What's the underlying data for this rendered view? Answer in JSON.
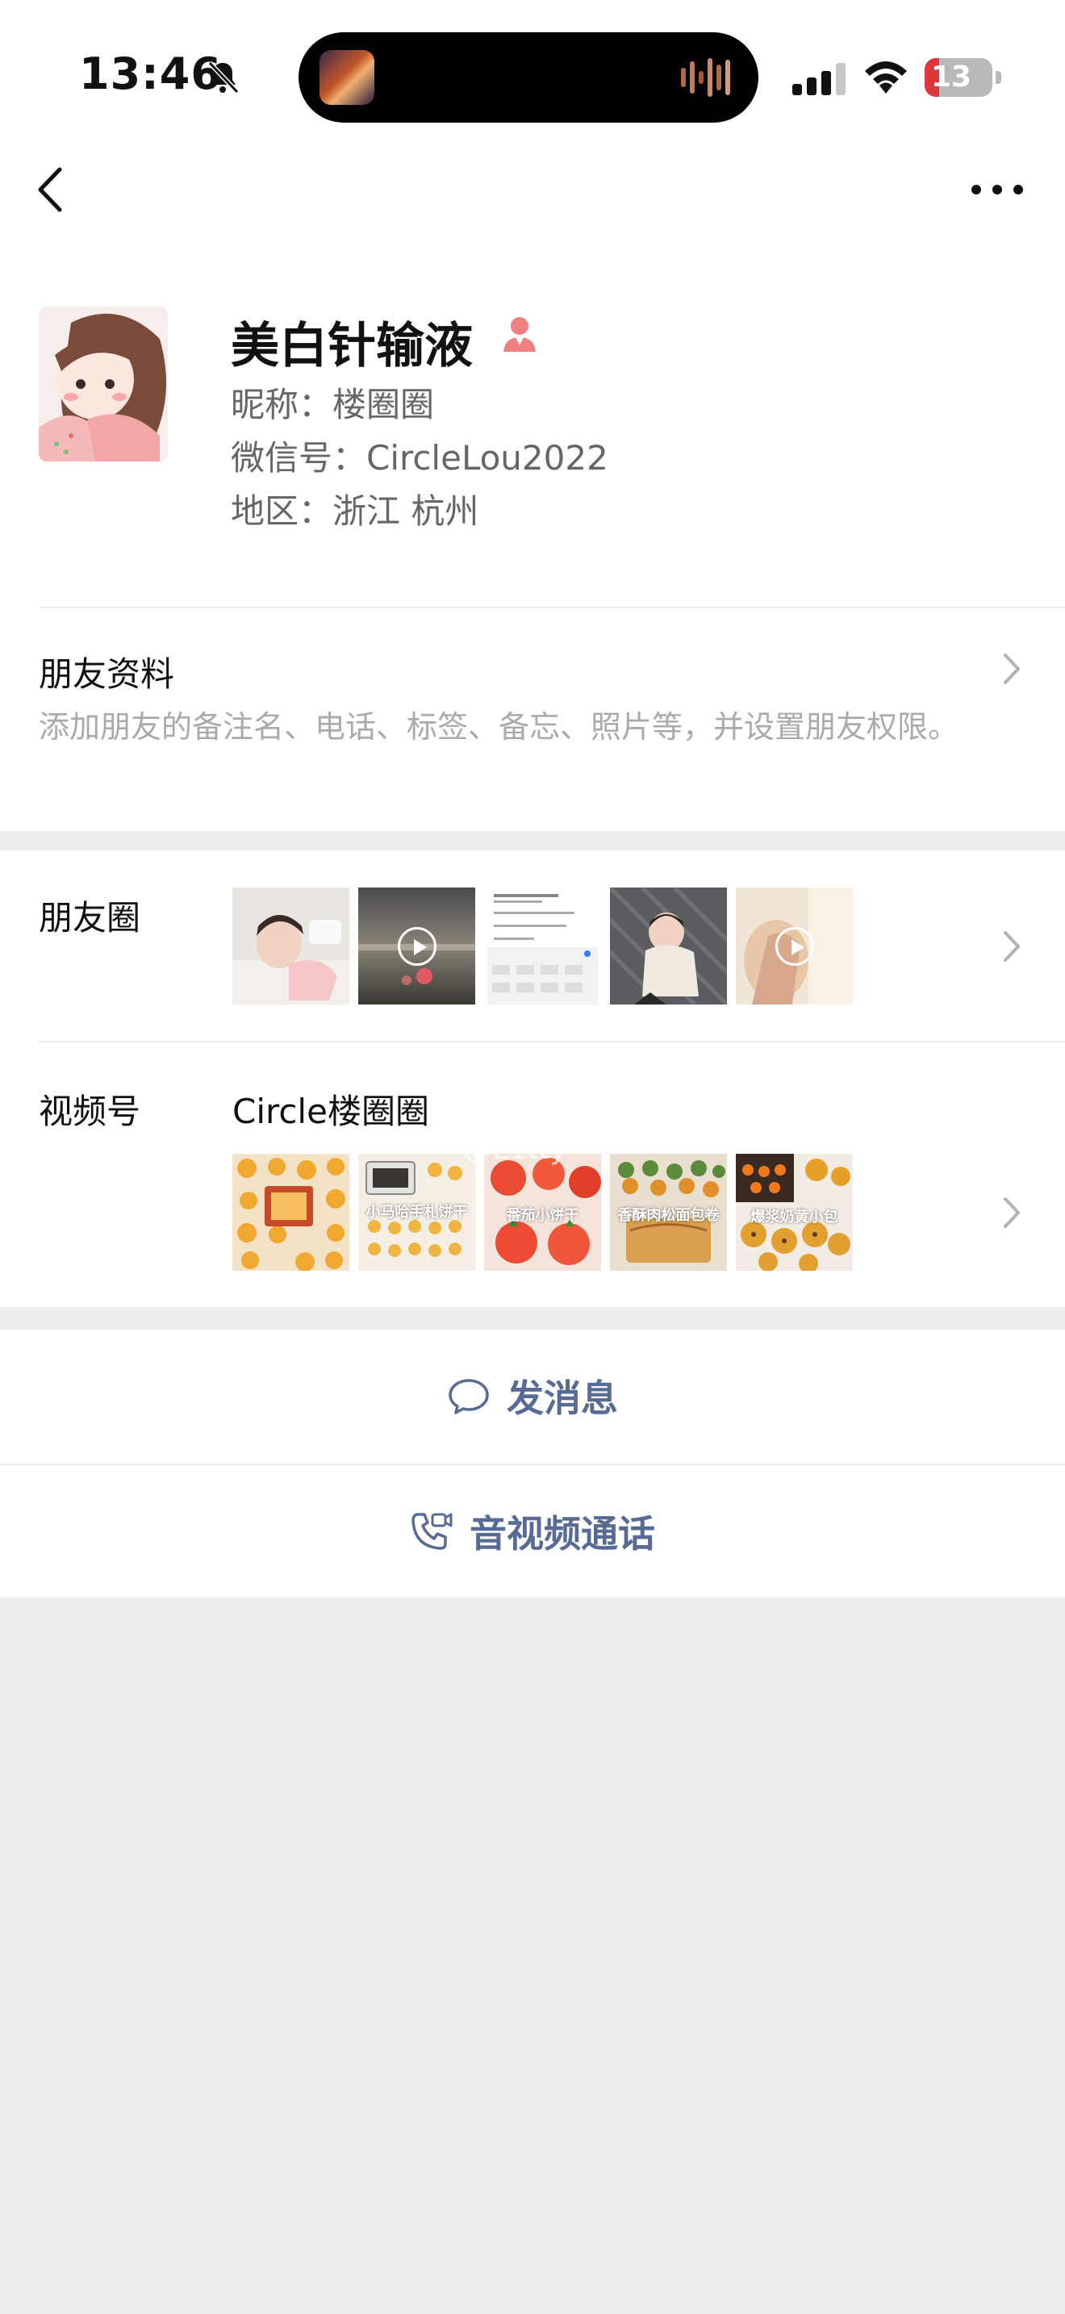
{
  "status_bar": {
    "time": "13:46",
    "battery_level": "13",
    "battery_color": "#e0353a"
  },
  "profile": {
    "remark_name": "美白针输液",
    "nickname": "昵称：楼圈圈",
    "wechat_id": "微信号：CircleLou2022",
    "region": "地区：浙江 杭州",
    "gender_icon_color": "#f08080"
  },
  "friend_info": {
    "title": "朋友资料",
    "description": "添加朋友的备注名、电话、标签、备忘、照片等，并设置朋友权限。"
  },
  "moments": {
    "label": "朋友圈"
  },
  "channels": {
    "label": "视频号",
    "name": "Circle楼圈圈",
    "watermark": "@L1tty",
    "captions": [
      "小马哈手札饼干",
      "番茄小饼干",
      "香酥肉松面包卷",
      "爆浆奶黄小包"
    ]
  },
  "actions": {
    "message": "发消息",
    "call": "音视频通话",
    "link_color": "#576b95"
  }
}
